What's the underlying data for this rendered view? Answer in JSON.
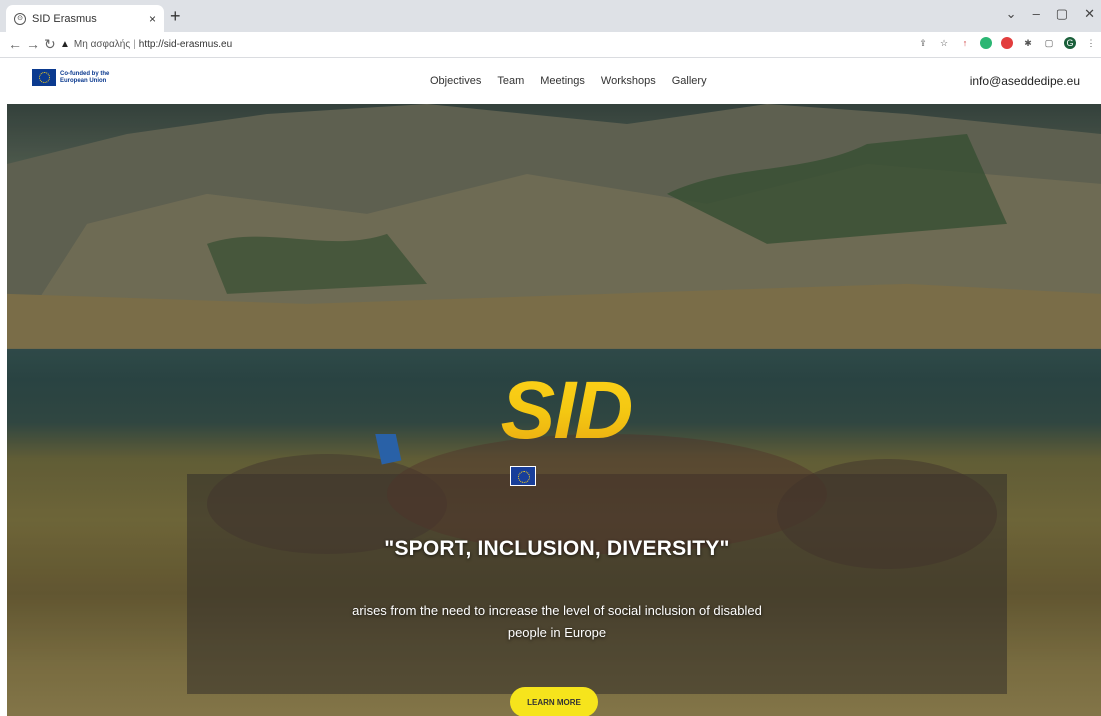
{
  "browser": {
    "tab_title": "SID Erasmus",
    "tab_close": "×",
    "new_tab": "+",
    "omnibox_security": "Μη ασφαλής",
    "omnibox_url": "http://sid-erasmus.eu",
    "window_controls": [
      "⌄",
      "–",
      "▢",
      "✕"
    ]
  },
  "site": {
    "logo_text": "Co-funded by the European Union",
    "nav": [
      "Objectives",
      "Team",
      "Meetings",
      "Workshops",
      "Gallery"
    ],
    "email": "info@aseddedipe.eu"
  },
  "hero": {
    "title": "SID",
    "slogan": "\"SPORT, INCLUSION, DIVERSITY\"",
    "subtitle": "arises from the need to increase the level of social inclusion of disabled people in Europe",
    "cta": "LEARN MORE"
  },
  "colors": {
    "accent_yellow": "#f6e41c",
    "eu_blue": "#0b3a8f"
  }
}
